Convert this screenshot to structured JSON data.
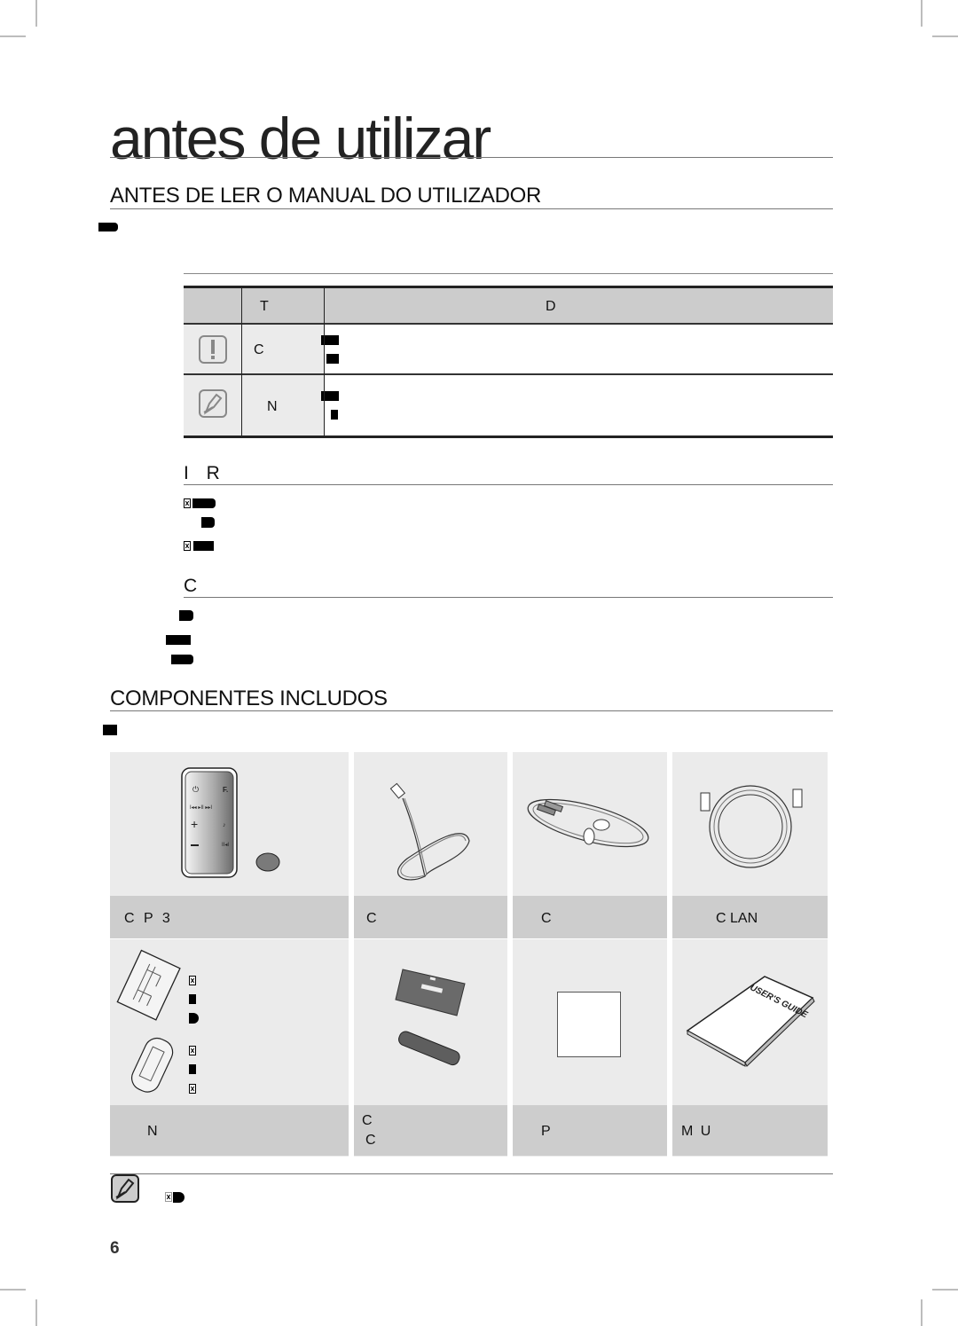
{
  "page": {
    "chapter_title": "antes de utilizar",
    "page_number": "6"
  },
  "section_before_reading": {
    "heading": "ANTES DE LER O MANUAL DO UTILIZADOR",
    "icon_table": {
      "headers": [
        "",
        "T",
        "D"
      ],
      "rows": [
        {
          "icon": "caution-icon",
          "term": "C"
        },
        {
          "icon": "note-icon",
          "term": "N"
        }
      ]
    },
    "subsection_instructions": {
      "heading": "I R"
    },
    "subsection_copyright": {
      "heading": "C"
    }
  },
  "section_components": {
    "heading": "COMPONENTES INCLUDOS",
    "items": [
      {
        "label": "C P 3",
        "image": "remote-control-and-battery"
      },
      {
        "label": "C",
        "image": "power-cable"
      },
      {
        "label": "C",
        "image": "audio-cable"
      },
      {
        "label": "C LAN",
        "image": "lan-cable"
      },
      {
        "label": "N",
        "image": "ferrite-cores"
      },
      {
        "label_line1": "C",
        "label_line2": "C",
        "image": "bracket-and-holder"
      },
      {
        "label": "P",
        "image": "folded-sheet"
      },
      {
        "label": "M U",
        "image": "users-guide",
        "book_text": "USER'S GUIDE"
      }
    ]
  },
  "footer_note": {
    "icon": "note-icon"
  }
}
